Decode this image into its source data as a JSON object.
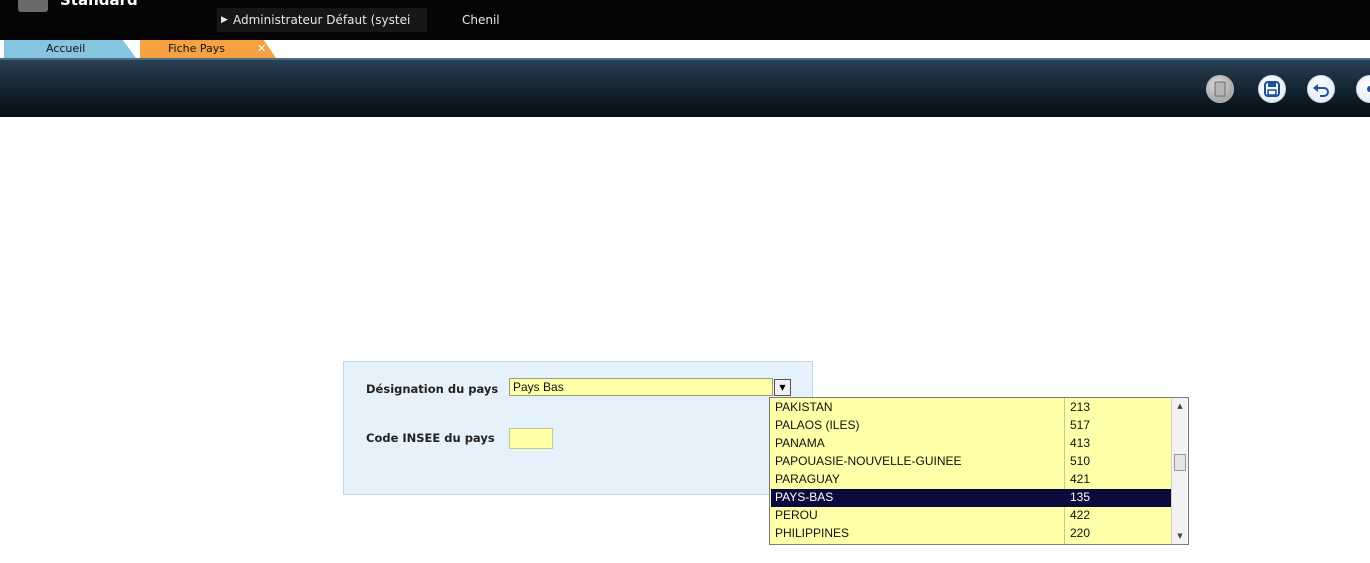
{
  "header": {
    "app_title": "Standard",
    "user": "Administrateur Défaut (systei",
    "site": "Chenil"
  },
  "tabs": [
    {
      "label": "Accueil",
      "active": false
    },
    {
      "label": "Fiche Pays",
      "active": true,
      "close": "✕"
    }
  ],
  "toolbar": {
    "buttons": [
      "new-icon",
      "save-icon",
      "undo-icon",
      "more-icon"
    ]
  },
  "form": {
    "designation_label": "Désignation du pays",
    "designation_value": "Pays Bas",
    "code_label": "Code INSEE du pays",
    "code_value": ""
  },
  "dropdown": {
    "items": [
      {
        "name": "PAKISTAN",
        "code": "213"
      },
      {
        "name": "PALAOS (ILES)",
        "code": "517"
      },
      {
        "name": "PANAMA",
        "code": "413"
      },
      {
        "name": "PAPOUASIE-NOUVELLE-GUINEE",
        "code": "510"
      },
      {
        "name": "PARAGUAY",
        "code": "421"
      },
      {
        "name": "PAYS-BAS",
        "code": "135"
      },
      {
        "name": "PEROU",
        "code": "422"
      },
      {
        "name": "PHILIPPINES",
        "code": "220"
      }
    ],
    "selected": "PAYS-BAS"
  },
  "colors": {
    "input_bg": "#ffffa8",
    "tab_home": "#86c5df",
    "tab_active": "#f6a243",
    "selection": "#0a0a3c",
    "panel_bg": "#e6f2fb"
  }
}
